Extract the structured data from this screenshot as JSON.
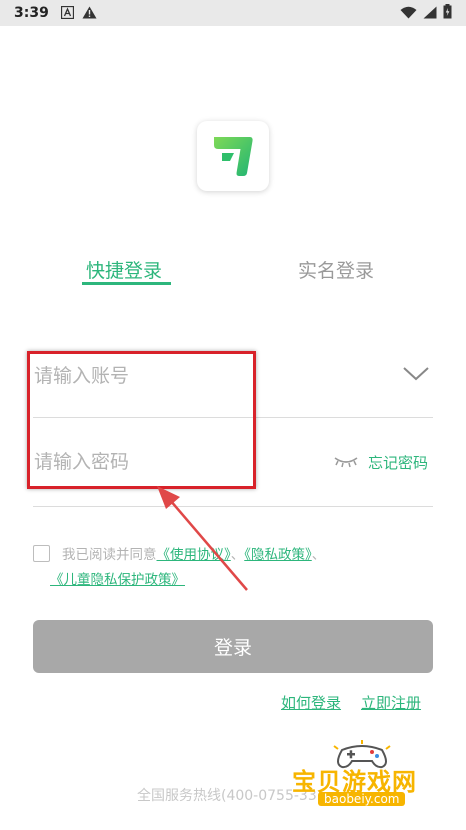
{
  "status_bar": {
    "time": "3:39"
  },
  "tabs": {
    "quick_login": "快捷登录",
    "real_name_login": "实名登录"
  },
  "form": {
    "account_placeholder": "请输入账号",
    "password_placeholder": "请输入密码",
    "forgot_password": "忘记密码"
  },
  "agreement": {
    "prefix": "我已阅读并同意",
    "user_agreement": "《使用协议》",
    "sep1": "、",
    "privacy_policy": "《隐私政策》",
    "sep2": "、",
    "children_privacy": "《儿童隐私保护政策》"
  },
  "login_button": "登录",
  "links": {
    "how_to_login": "如何登录",
    "register": "立即注册"
  },
  "hotline": "全国服务热线(400-0755-33",
  "watermark": {
    "title": "宝贝游戏网",
    "url": "baobeiy.com"
  },
  "colors": {
    "accent_green": "#2db67c",
    "disabled_button": "#a8a8a8",
    "annotation_red": "#d8222a"
  }
}
